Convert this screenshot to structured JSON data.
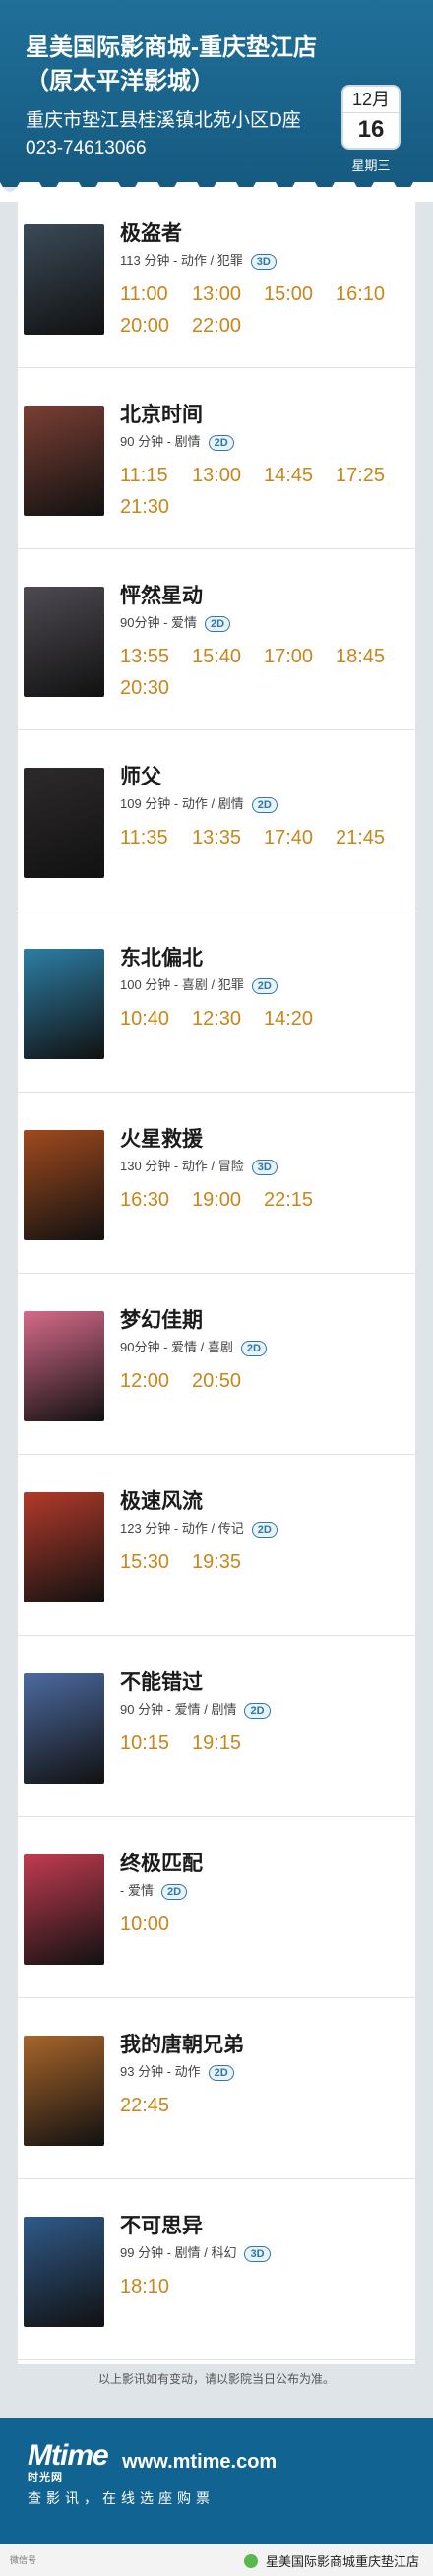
{
  "header": {
    "cinema_name": "星美国际影商城-重庆垫江店（原太平洋影城）",
    "address": "重庆市垫江县桂溪镇北苑小区D座",
    "phone": "023-74613066",
    "date": {
      "month": "12月",
      "day": "16",
      "weekday": "星期三"
    }
  },
  "movies": [
    {
      "title": "极盗者",
      "meta": "113 分钟 - 动作 / 犯罪",
      "format": "3D",
      "times": [
        "11:00",
        "13:00",
        "15:00",
        "16:10",
        "20:00",
        "22:00"
      ],
      "poster_color": "#3a4a58"
    },
    {
      "title": "北京时间",
      "meta": "90 分钟 - 剧情",
      "format": "2D",
      "times": [
        "11:15",
        "13:00",
        "14:45",
        "17:25",
        "21:30"
      ],
      "poster_color": "#7a3f33"
    },
    {
      "title": "怦然星动",
      "meta": "90分钟 - 爱情",
      "format": "2D",
      "times": [
        "13:55",
        "15:40",
        "17:00",
        "18:45",
        "20:30"
      ],
      "poster_color": "#4e4a52"
    },
    {
      "title": "师父",
      "meta": "109 分钟 - 动作 / 剧情",
      "format": "2D",
      "times": [
        "11:35",
        "13:35",
        "17:40",
        "21:45"
      ],
      "poster_color": "#2e2a2c"
    },
    {
      "title": "东北偏北",
      "meta": "100 分钟 - 喜剧 / 犯罪",
      "format": "2D",
      "times": [
        "10:40",
        "12:30",
        "14:20"
      ],
      "poster_color": "#2c7ea5"
    },
    {
      "title": "火星救援",
      "meta": "130 分钟 - 动作 / 冒险",
      "format": "3D",
      "times": [
        "16:30",
        "19:00",
        "22:15"
      ],
      "poster_color": "#a14a1d"
    },
    {
      "title": "梦幻佳期",
      "meta": "90分钟 - 爱情 / 喜剧",
      "format": "2D",
      "times": [
        "12:00",
        "20:50"
      ],
      "poster_color": "#d66a8a"
    },
    {
      "title": "极速风流",
      "meta": "123 分钟 - 动作 / 传记",
      "format": "2D",
      "times": [
        "15:30",
        "19:35"
      ],
      "poster_color": "#b23a2a"
    },
    {
      "title": "不能错过",
      "meta": "90 分钟 - 爱情 / 剧情",
      "format": "2D",
      "times": [
        "10:15",
        "19:15"
      ],
      "poster_color": "#4c6aa0"
    },
    {
      "title": "终极匹配",
      "meta": "- 爱情",
      "format": "2D",
      "times": [
        "10:00"
      ],
      "poster_color": "#c23b50"
    },
    {
      "title": "我的唐朝兄弟",
      "meta": "93 分钟 - 动作",
      "format": "2D",
      "times": [
        "22:45"
      ],
      "poster_color": "#a8652a"
    },
    {
      "title": "不可思异",
      "meta": "99 分钟 - 剧情 / 科幻",
      "format": "3D",
      "times": [
        "18:10"
      ],
      "poster_color": "#2f5a8a"
    }
  ],
  "footer": {
    "note": "以上影讯如有变动，请以影院当日公布为准。",
    "brand": "Mtime",
    "brand_sub": "时光网",
    "url": "www.mtime.com",
    "slogan": "查影讯，在线选座购票",
    "wechat_left": "微信号",
    "wechat_account": "星美国际影商城重庆垫江店"
  }
}
